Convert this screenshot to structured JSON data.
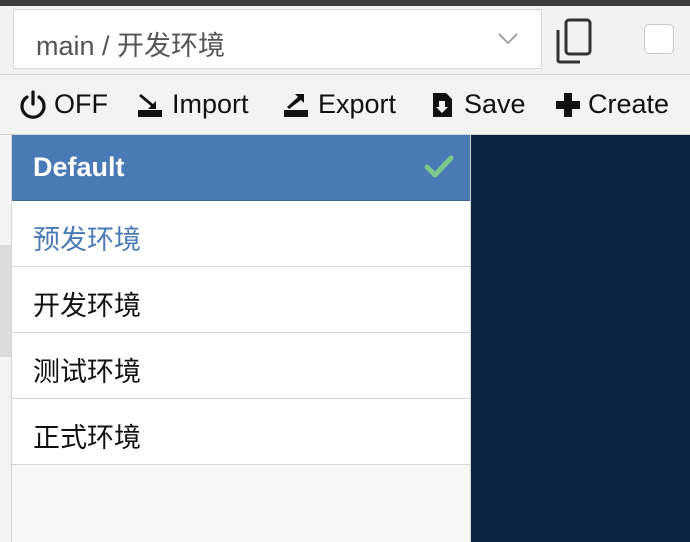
{
  "selector": {
    "value": "main / 开发环境",
    "icon": "chevron-down-icon"
  },
  "toolbar": {
    "power_label": "OFF",
    "import_label": "Import",
    "export_label": "Export",
    "save_label": "Save",
    "create_label": "Create"
  },
  "env_list": {
    "items": [
      {
        "label": "Default",
        "state": "active"
      },
      {
        "label": "预发环境",
        "state": "hover"
      },
      {
        "label": "开发环境",
        "state": "normal"
      },
      {
        "label": "测试环境",
        "state": "normal"
      },
      {
        "label": "正式环境",
        "state": "normal"
      }
    ]
  },
  "colors": {
    "accent": "#4a7ab5",
    "check": "#79c78a",
    "editor_bg": "#0d2342"
  }
}
